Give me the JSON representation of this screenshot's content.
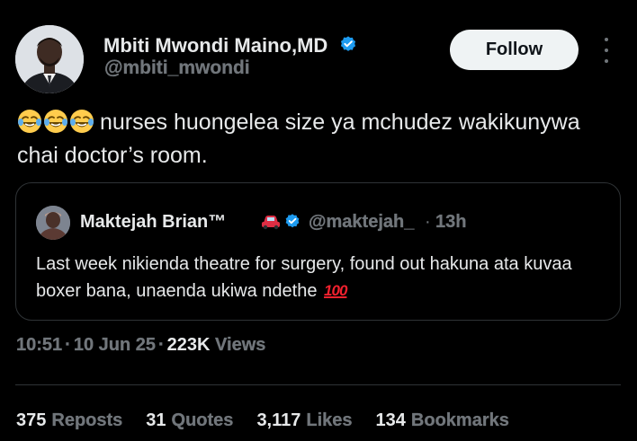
{
  "author": {
    "name": "Mbiti Mwondi Maino,MD",
    "handle": "@mbiti_mwondi",
    "verified": true
  },
  "follow_label": "Follow",
  "tweet": {
    "emojis": [
      "rolling-on-floor-laughing",
      "rolling-on-floor-laughing",
      "rolling-on-floor-laughing"
    ],
    "text": "nurses huongelea size ya mchudez wakikunywa chai doctor’s room."
  },
  "quote": {
    "name": "Maktejah Brian™",
    "handle": "@maktejah_",
    "separator": "·",
    "time": "13h",
    "text": "Last week nikienda theatre for surgery, found out hakuna ata kuvaa boxer bana, unaenda ukiwa ndethe",
    "hundred": "100"
  },
  "meta": {
    "time": "10:51",
    "date": "10 Jun 25",
    "views_count": "223K",
    "views_label": "Views",
    "separator": "·"
  },
  "stats": [
    {
      "count": "375",
      "label": "Reposts"
    },
    {
      "count": "31",
      "label": "Quotes"
    },
    {
      "count": "3,117",
      "label": "Likes"
    },
    {
      "count": "134",
      "label": "Bookmarks"
    }
  ],
  "colors": {
    "background": "#000000",
    "text": "#e7e9ea",
    "muted": "#71767b",
    "verified": "#1d9bf0",
    "border": "#2f3336"
  }
}
